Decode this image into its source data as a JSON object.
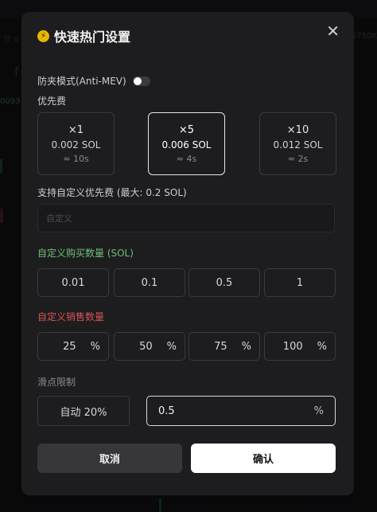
{
  "background": {
    "bg_text_1": "分 s",
    "bg_text_2": "f",
    "bg_text_3": "0093",
    "bg_text_4": "6750K"
  },
  "modal": {
    "title": "快速热门设置",
    "title_icon": "lightning-icon",
    "close_icon": "close-icon",
    "anti_mev": {
      "label": "防夹模式(Anti-MEV)",
      "enabled": false
    },
    "priority": {
      "label": "优先费",
      "options": [
        {
          "multiplier": "×1",
          "amount": "0.002 SOL",
          "eta": "≈ 10s",
          "selected": false
        },
        {
          "multiplier": "×5",
          "amount": "0.006 SOL",
          "eta": "≈ 4s",
          "selected": true
        },
        {
          "multiplier": "×10",
          "amount": "0.012 SOL",
          "eta": "≈ 2s",
          "selected": false
        }
      ]
    },
    "custom_fee": {
      "label": "支持自定义优先费 (最大: 0.2 SOL)",
      "placeholder": "自定义"
    },
    "buy": {
      "label": "自定义购买数量 (SOL)",
      "amounts": [
        "0.01",
        "0.1",
        "0.5",
        "1"
      ]
    },
    "sell": {
      "label": "自定义销售数量",
      "percents": [
        "25",
        "50",
        "75",
        "100"
      ],
      "unit": "%"
    },
    "slippage": {
      "label": "滑点限制",
      "auto_label": "自动 20%",
      "value": "0.5",
      "unit": "%"
    },
    "cancel_label": "取消",
    "confirm_label": "确认"
  },
  "colors": {
    "modal_bg": "#1d1d20",
    "buy_label": "#6fbf73",
    "sell_label": "#d9534f",
    "confirm_bg": "#ffffff",
    "cancel_bg": "#36363b"
  }
}
